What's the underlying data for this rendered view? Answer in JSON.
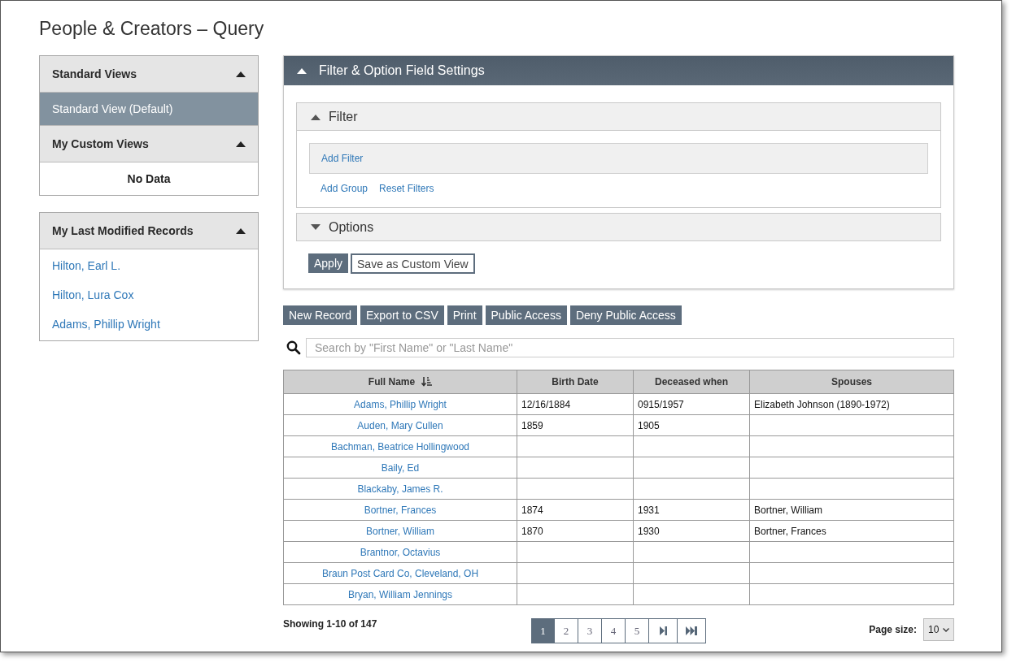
{
  "page_title": "People & Creators – Query",
  "views_panel": {
    "sections": [
      {
        "title": "Standard Views",
        "expanded": true,
        "items": [
          {
            "label": "Standard View (Default)",
            "selected": true
          }
        ]
      },
      {
        "title": "My Custom Views",
        "expanded": true,
        "empty_text": "No Data"
      }
    ]
  },
  "recent_panel": {
    "title": "My Last Modified Records",
    "expanded": true,
    "items": [
      "Hilton, Earl L.",
      "Hilton, Lura Cox",
      "Adams, Phillip Wright"
    ]
  },
  "settings_panel": {
    "title": "Filter & Option Field Settings",
    "expanded": true,
    "filter": {
      "title": "Filter",
      "expanded": true,
      "add_filter": "Add Filter",
      "links": [
        "Add Group",
        "Reset Filters"
      ]
    },
    "options": {
      "title": "Options",
      "expanded": false
    },
    "apply_button": "Apply",
    "save_button": "Save as Custom View"
  },
  "toolbar": [
    "New Record",
    "Export to CSV",
    "Print",
    "Public Access",
    "Deny Public Access"
  ],
  "search": {
    "placeholder": "Search by \"First Name\" or \"Last Name\""
  },
  "table": {
    "columns": [
      {
        "label": "Full Name",
        "sorted": true
      },
      {
        "label": "Birth Date",
        "sorted": false
      },
      {
        "label": "Deceased when",
        "sorted": false
      },
      {
        "label": "Spouses",
        "sorted": false
      }
    ],
    "rows": [
      [
        "Adams, Phillip Wright",
        "12/16/1884",
        "0915/1957",
        "Elizabeth Johnson (1890-1972)"
      ],
      [
        "Auden, Mary Cullen",
        "1859",
        "1905",
        ""
      ],
      [
        "Bachman, Beatrice Hollingwood",
        "",
        "",
        ""
      ],
      [
        "Baily, Ed",
        "",
        "",
        ""
      ],
      [
        "Blackaby, James R.",
        "",
        "",
        ""
      ],
      [
        "Bortner, Frances",
        "1874",
        "1931",
        "Bortner, William"
      ],
      [
        "Bortner, William",
        "1870",
        "1930",
        "Bortner, Frances"
      ],
      [
        "Brantnor, Octavius",
        "",
        "",
        ""
      ],
      [
        "Braun Post Card Co, Cleveland, OH",
        "",
        "",
        ""
      ],
      [
        "Bryan, William Jennings",
        "",
        "",
        ""
      ]
    ]
  },
  "footer": {
    "showing": "Showing 1-10 of 147",
    "pages": [
      {
        "kind": "page",
        "label": "1",
        "selected": true
      },
      {
        "kind": "page",
        "label": "2",
        "selected": false
      },
      {
        "kind": "page",
        "label": "3",
        "selected": false
      },
      {
        "kind": "page",
        "label": "4",
        "selected": false
      },
      {
        "kind": "page",
        "label": "5",
        "selected": false
      },
      {
        "kind": "next",
        "selected": false
      },
      {
        "kind": "last",
        "selected": false
      }
    ],
    "page_size_label": "Page size:",
    "page_size": "10"
  }
}
